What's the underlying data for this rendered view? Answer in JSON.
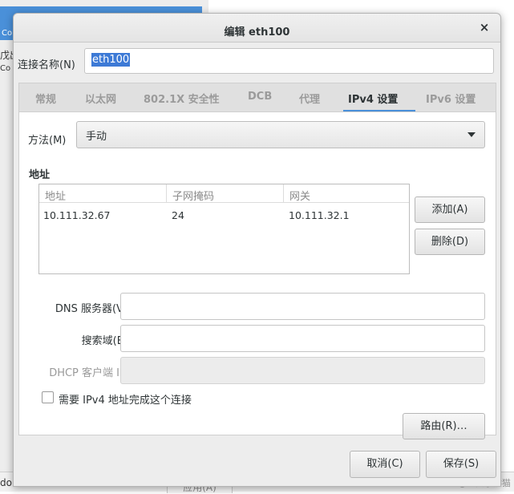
{
  "background": {
    "header_fragment": "Co",
    "side_fragment": "戊出",
    "side_fragment2": "Co",
    "domain_text": "domain",
    "apply_label": "应用(A)",
    "watermark": "CSDN @一只小熊猫"
  },
  "dialog": {
    "title": "编辑 eth100",
    "close_glyph": "×"
  },
  "connection": {
    "label": "连接名称(N)",
    "value": "eth100"
  },
  "tabs": [
    {
      "label": "常规",
      "active": false
    },
    {
      "label": "以太网",
      "active": false
    },
    {
      "label": "802.1X 安全性",
      "active": false
    },
    {
      "label": "DCB",
      "active": false
    },
    {
      "label": "代理",
      "active": false
    },
    {
      "label": "IPv4 设置",
      "active": true
    },
    {
      "label": "IPv6 设置",
      "active": false
    }
  ],
  "ipv4": {
    "method_label": "方法(M)",
    "method_value": "手动",
    "section_title": "地址",
    "table": {
      "columns": [
        "地址",
        "子网掩码",
        "网关"
      ],
      "rows": [
        [
          "10.111.32.67",
          "24",
          "10.111.32.1"
        ]
      ]
    },
    "add_label": "添加(A)",
    "delete_label": "删除(D)",
    "dns_label": "DNS 服务器(V)",
    "dns_value": "",
    "search_label": "搜索域(E)",
    "search_value": "",
    "dhcp_label": "DHCP 客户端 ID",
    "dhcp_value": "",
    "require_label": "需要 IPv4 地址完成这个连接",
    "require_checked": false,
    "routes_label": "路由(R)…"
  },
  "footer": {
    "cancel_label": "取消(C)",
    "save_label": "保存(S)"
  },
  "colors": {
    "accent": "#4a90d9",
    "selection": "#3d7ad6"
  }
}
